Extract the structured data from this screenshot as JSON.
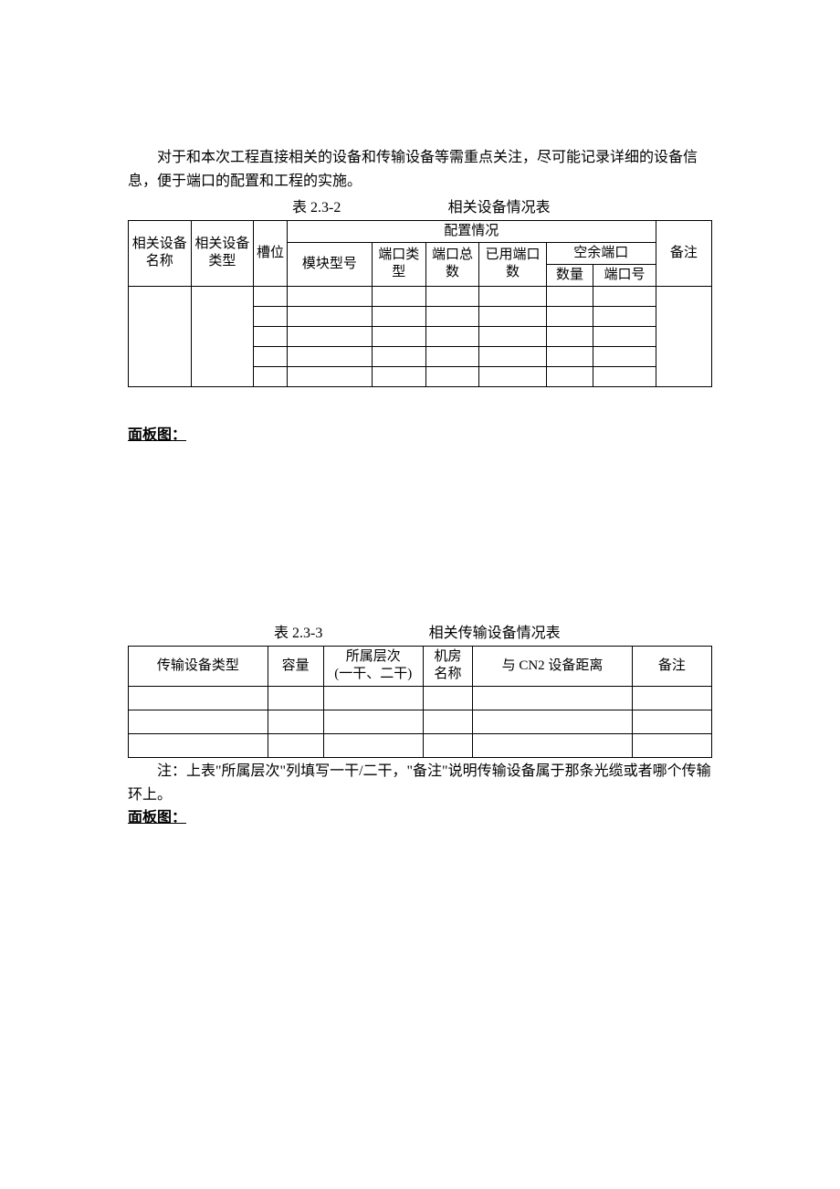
{
  "para1": "对于和本次工程直接相关的设备和传输设备等需重点关注，尽可能记录详细的设备信息，便于端口的配置和工程的实施。",
  "table1": {
    "title_num": "表 2.3-2",
    "title_name": "相关设备情况表",
    "headers": {
      "h1": "相关设备名称",
      "h2": "相关设备类型",
      "h3": "槽位",
      "h4": "配置情况",
      "h5": "备注",
      "h41": "模块型号",
      "h42": "端口类型",
      "h43": "端口总数",
      "h44": "已用端口数",
      "h45": "空余端口",
      "h451": "数量",
      "h452": "端口号"
    },
    "rows": [
      {
        "c1": "",
        "c2": "",
        "c3": "",
        "c4": "",
        "c5": "",
        "c6": "",
        "c7": "",
        "c8": "",
        "c9": "",
        "c10": ""
      },
      {
        "c3": "",
        "c4": "",
        "c5": "",
        "c6": "",
        "c7": "",
        "c8": "",
        "c9": ""
      },
      {
        "c3": "",
        "c4": "",
        "c5": "",
        "c6": "",
        "c7": "",
        "c8": "",
        "c9": ""
      },
      {
        "c3": "",
        "c4": "",
        "c5": "",
        "c6": "",
        "c7": "",
        "c8": "",
        "c9": ""
      },
      {
        "c3": "",
        "c4": "",
        "c5": "",
        "c6": "",
        "c7": "",
        "c8": "",
        "c9": ""
      }
    ]
  },
  "heading1": "面板图：",
  "table2": {
    "title_num": "表 2.3-3",
    "title_name": "相关传输设备情况表",
    "headers": {
      "h1": "传输设备类型",
      "h2": "容量",
      "h3_l1": "所属层次",
      "h3_l2": "(一干、二干)",
      "h4_l1": "机房",
      "h4_l2": "名称",
      "h5": "与 CN2 设备距离",
      "h6": "备注"
    },
    "rows": [
      {
        "c1": "",
        "c2": "",
        "c3": "",
        "c4": "",
        "c5": "",
        "c6": ""
      },
      {
        "c1": "",
        "c2": "",
        "c3": "",
        "c4": "",
        "c5": "",
        "c6": ""
      },
      {
        "c1": "",
        "c2": "",
        "c3": "",
        "c4": "",
        "c5": "",
        "c6": ""
      }
    ]
  },
  "note2": "注：上表\"所属层次\"列填写一干/二干，\"备注\"说明传输设备属于那条光缆或者哪个传输环上。",
  "heading2": "面板图："
}
